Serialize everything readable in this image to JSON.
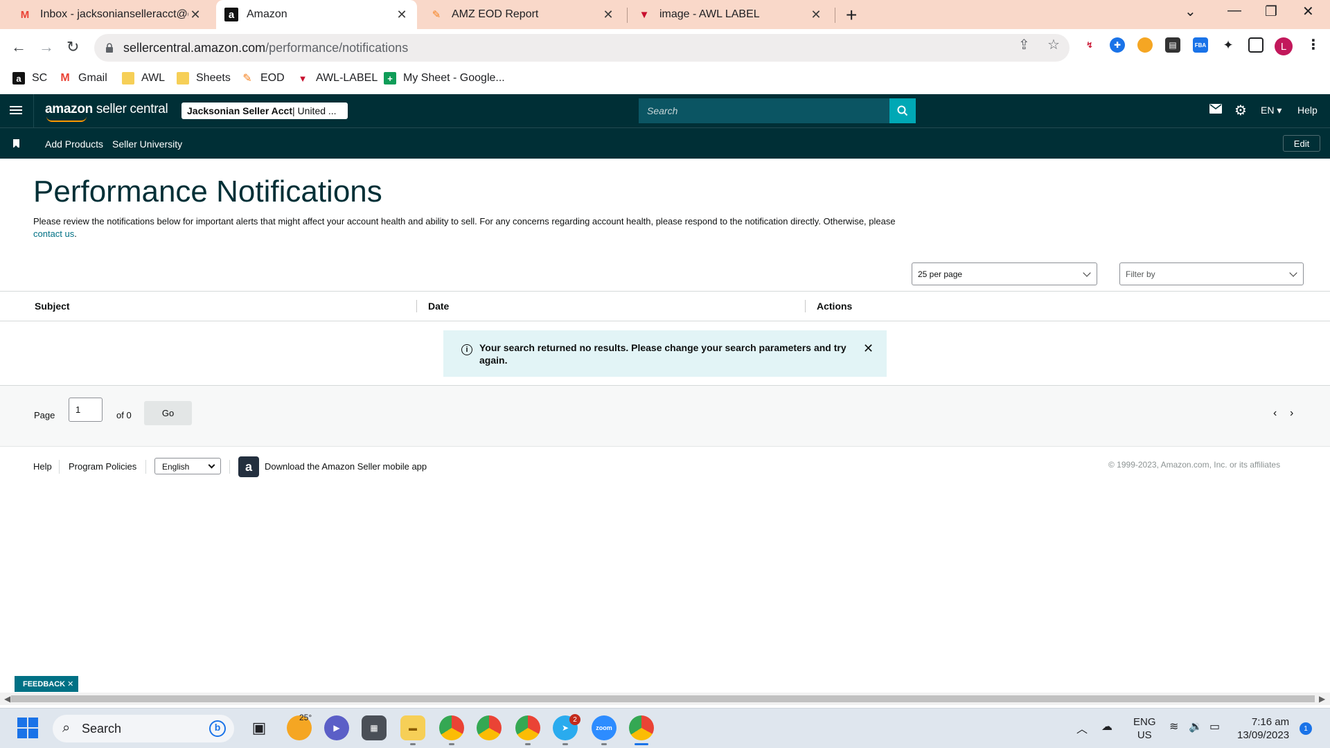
{
  "browser": {
    "tabs": [
      {
        "label": "Inbox - jacksonianselleracct@gm",
        "icon": "gmail-icon"
      },
      {
        "label": "Amazon",
        "icon": "amazon-icon"
      },
      {
        "label": "AMZ EOD Report",
        "icon": "pencil-doc-icon"
      },
      {
        "label": "image - AWL LABEL",
        "icon": "awl-icon"
      }
    ],
    "url_host": "sellercentral.amazon.com",
    "url_path": "/performance/notifications",
    "profile_initial": "L",
    "bookmarks": [
      {
        "label": "SC",
        "icon": "amazon-icon"
      },
      {
        "label": "Gmail",
        "icon": "gmail-icon"
      },
      {
        "label": "AWL",
        "icon": "folder-icon"
      },
      {
        "label": "Sheets",
        "icon": "folder-icon"
      },
      {
        "label": "EOD",
        "icon": "pencil-doc-icon"
      },
      {
        "label": "AWL-LABEL",
        "icon": "awl-icon"
      },
      {
        "label": "My Sheet - Google...",
        "icon": "sheets-icon"
      }
    ]
  },
  "header": {
    "brand_a": "amazon",
    "brand_b": " seller central",
    "account_name": "Jacksonian Seller Acct",
    "account_region": " | United ...",
    "search_placeholder": "Search",
    "language": "EN",
    "help": "Help",
    "subnav": [
      "Add Products",
      "Seller University"
    ],
    "edit": "Edit"
  },
  "main": {
    "title": "Performance Notifications",
    "description": "Please review the notifications below for important alerts that might affect your account health and ability to sell. For any concerns regarding account health, please respond to the notification directly. Otherwise, please ",
    "contact_link": "contact us",
    "description_end": ".",
    "per_page": "25 per page",
    "filter": "Filter by",
    "columns": [
      "Subject",
      "Date",
      "Actions"
    ],
    "alert_message": "Your search returned no results. Please change your search parameters and try again.",
    "pager": {
      "page_label": "Page",
      "page_value": "1",
      "of_label": "of 0",
      "go": "Go"
    }
  },
  "footer": {
    "help": "Help",
    "policies": "Program Policies",
    "language": "English",
    "app_download": "Download the Amazon Seller mobile app",
    "copyright": "© 1999-2023, Amazon.com, Inc. or its affiliates"
  },
  "feedback": "FEEDBACK",
  "taskbar": {
    "search": "Search",
    "weather": "25°",
    "lang_line1": "ENG",
    "lang_line2": "US",
    "time": "7:16 am",
    "date": "13/09/2023",
    "notification_count": "1",
    "telegram_badge": "2"
  },
  "colors": {
    "sc_header": "#002f36",
    "search_button": "#00a8b5",
    "alert_bg": "#e2f4f6",
    "link": "#007185",
    "tab_bar": "#f9d8c9"
  }
}
